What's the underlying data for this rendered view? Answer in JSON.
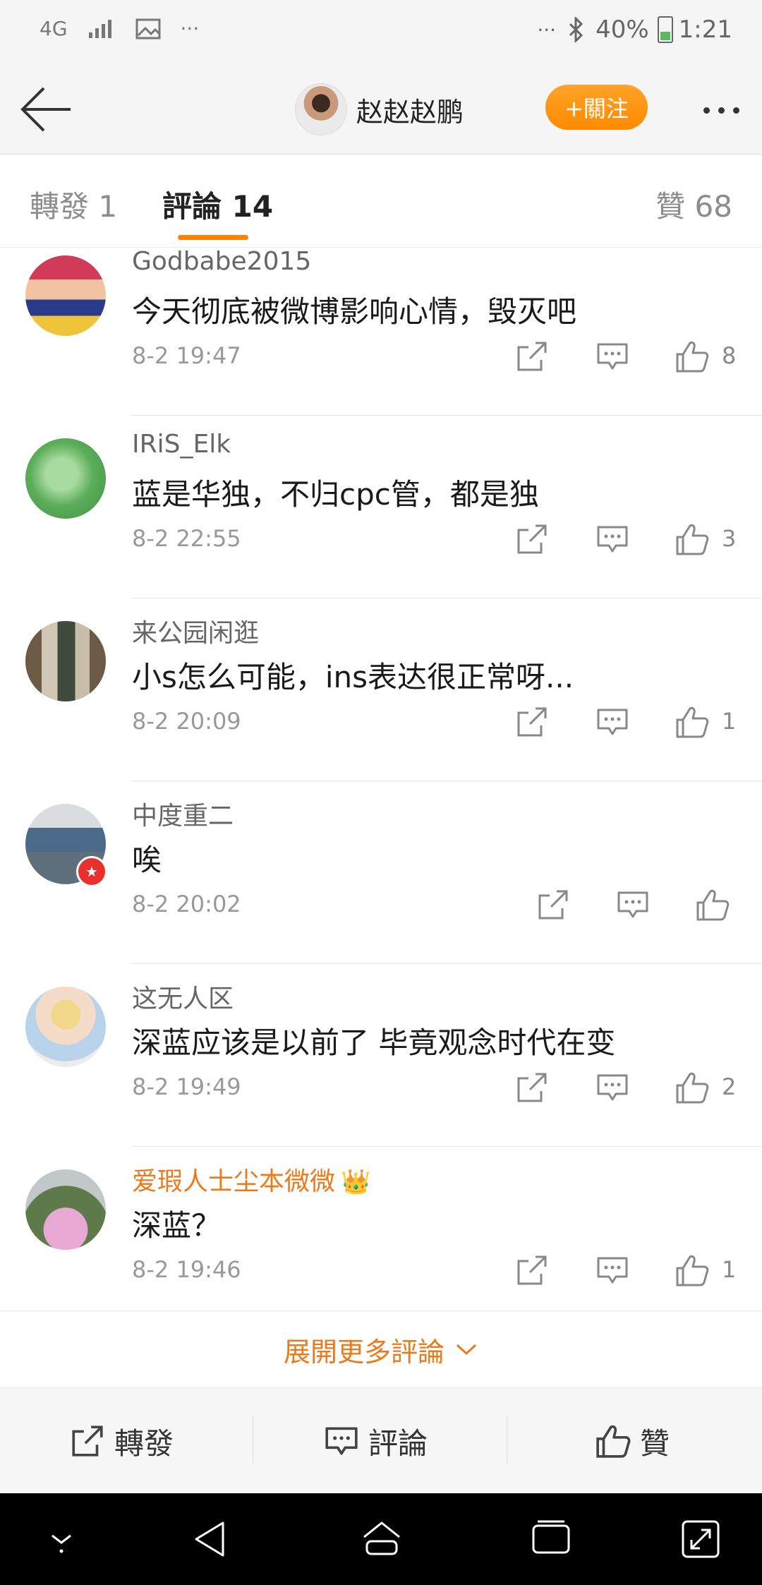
{
  "status_bar": {
    "network": "4G",
    "more_left": "···",
    "more_right": "···",
    "battery": "40%",
    "time": "1:21"
  },
  "header": {
    "username": "赵赵赵鹏",
    "follow_label": "+關注"
  },
  "tabs": {
    "repost": "轉發 1",
    "comment": "評論 14",
    "like": "贊 68"
  },
  "comments": [
    {
      "name": "Godbabe2015",
      "text": "今天彻底被微博影响心情，毁灭吧",
      "time": "8-2 19:47",
      "likes": "8"
    },
    {
      "name": "IRiS_Elk",
      "text": "蓝是华独，不归cpc管，都是独",
      "time": "8-2 22:55",
      "likes": "3"
    },
    {
      "name": "来公园闲逛",
      "text": "小s怎么可能，ins表达很正常呀...",
      "time": "8-2 20:09",
      "likes": "1"
    },
    {
      "name": "中度重二",
      "text": "唉",
      "time": "8-2 20:02",
      "likes": ""
    },
    {
      "name": "这无人区",
      "text": "深蓝应该是以前了 毕竟观念时代在变",
      "time": "8-2 19:49",
      "likes": "2"
    },
    {
      "name": "爱瑕人士尘本微微",
      "text": "深蓝？",
      "time": "8-2 19:46",
      "likes": "1"
    }
  ],
  "expand_label": "展開更多評論",
  "bottom_bar": {
    "repost": "轉發",
    "comment": "評論",
    "like": "贊"
  },
  "colors": {
    "accent": "#ff8200",
    "vip_name": "#eb7a1b"
  }
}
